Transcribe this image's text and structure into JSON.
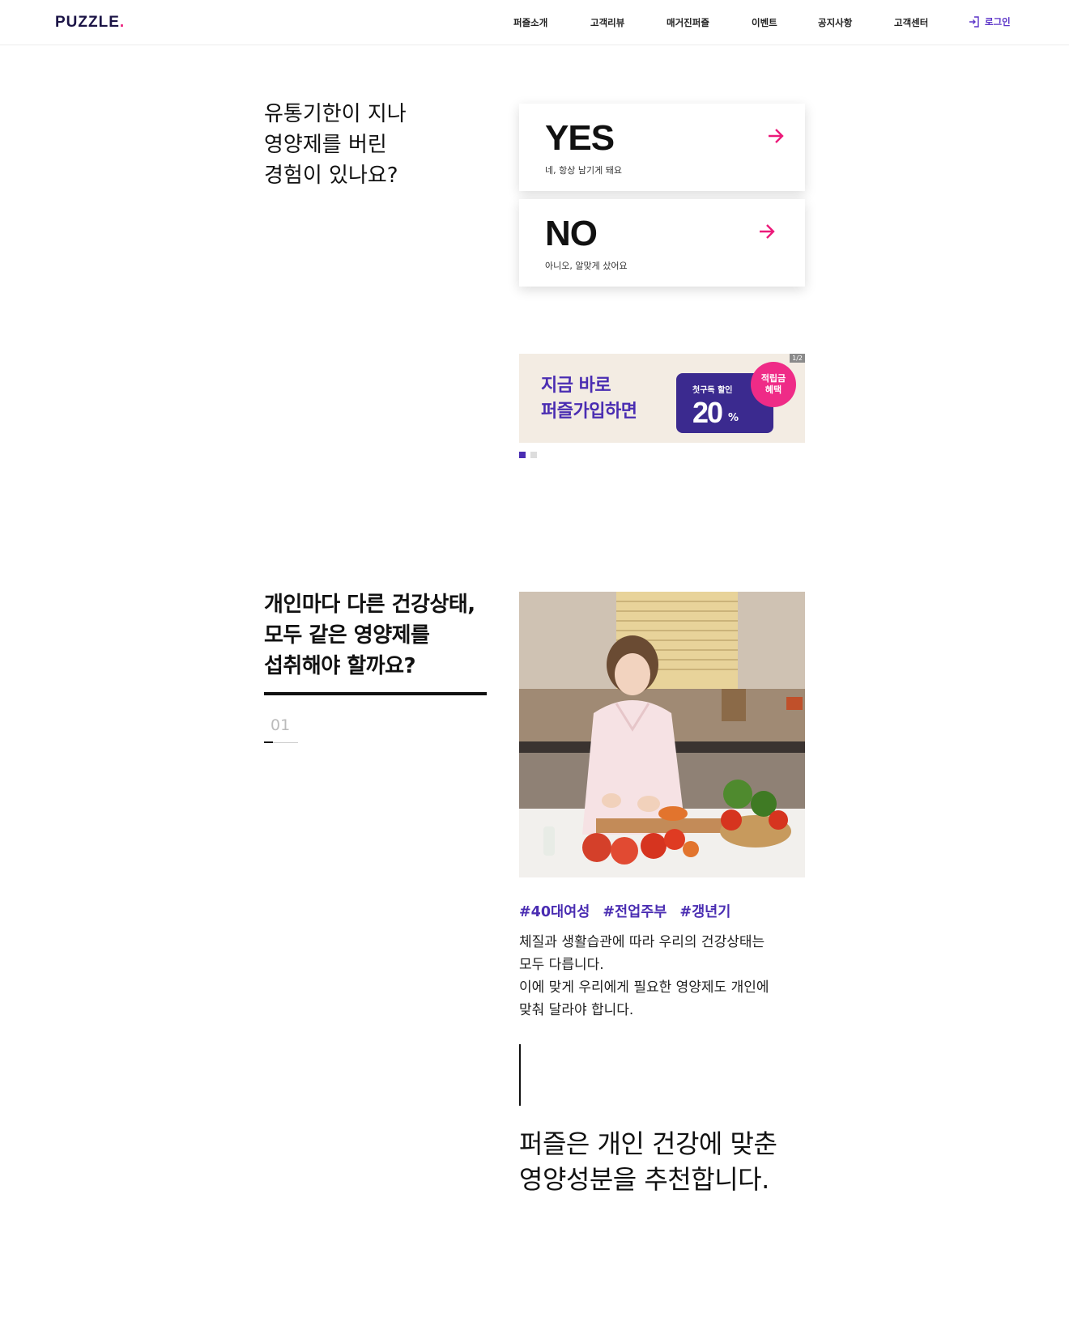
{
  "header": {
    "logo": "PUZZLE",
    "logo_dot": ".",
    "nav": [
      "퍼즐소개",
      "고객리뷰",
      "매거진퍼즐",
      "이벤트",
      "공지사항",
      "고객센터"
    ],
    "login_label": "로그인",
    "login_icon": "login-arrow-icon"
  },
  "question": {
    "title_lines": [
      "유통기한이 지나",
      "영양제를 버린",
      "경험이 있나요?"
    ],
    "yes": {
      "label": "YES",
      "sub": "네, 항상 남기게 돼요",
      "icon": "arrow-right-icon"
    },
    "no": {
      "label": "NO",
      "sub": "아니오, 알맞게 샀어요",
      "icon": "arrow-right-icon"
    }
  },
  "banner": {
    "line1": "지금 바로",
    "line2": "퍼즐가입하면",
    "coupon_label": "첫구독 할인",
    "coupon_value": "20",
    "coupon_unit": "%",
    "badge_line1": "적립금",
    "badge_line2": "혜택",
    "page_counter": "1/2",
    "slides": 2,
    "active_slide": 1
  },
  "section2": {
    "heading_lines": [
      "개인마다 다른 건강상태,",
      "모두 같은 영양제를",
      "섭취해야 할까요?"
    ],
    "step": "01",
    "tags": [
      "#40대여성",
      "#전업주부",
      "#갱년기"
    ],
    "desc_lines": [
      "체질과 생활습관에 따라 우리의 건강상태는",
      "모두 다릅니다.",
      "이에 맞게 우리에게 필요한 영양제도 개인에",
      "맞춰 달라야 합니다."
    ],
    "closing_lines": [
      "퍼즐은 개인 건강에 맞춘",
      "영양성분을 추천합니다."
    ]
  },
  "colors": {
    "brand": "#1b1446",
    "accent_pink": "#ec1a7a",
    "accent_purple": "#4a2db2"
  }
}
